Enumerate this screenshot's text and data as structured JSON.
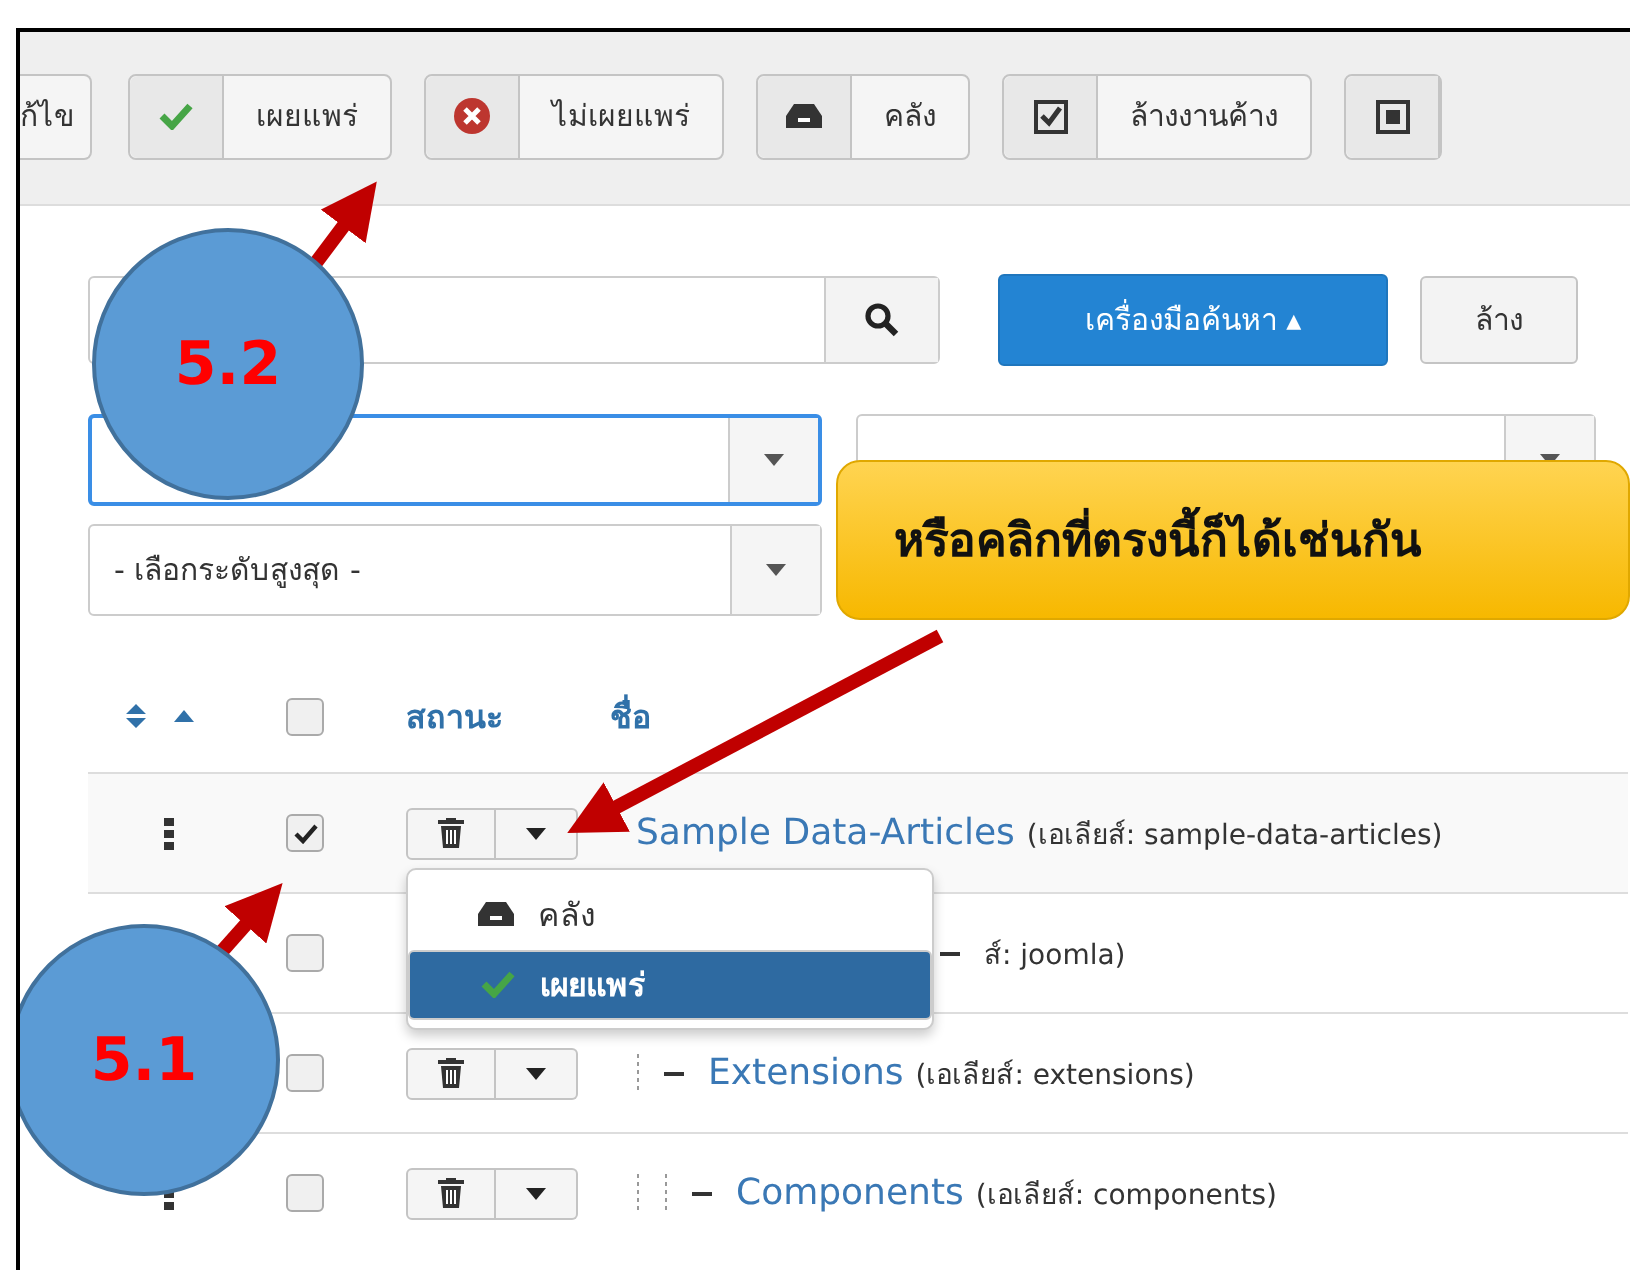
{
  "toolbar": {
    "buttons": [
      {
        "kind": "text",
        "label": "ก้ไข"
      },
      {
        "kind": "publish",
        "label": "เผยแพร่"
      },
      {
        "kind": "unpublish",
        "label": "ไม่เผยแพร่"
      },
      {
        "kind": "archive",
        "label": "คลัง"
      },
      {
        "kind": "checkin",
        "label": "ล้างงานค้าง"
      },
      {
        "kind": "stop"
      }
    ]
  },
  "search": {
    "tools_button": "เครื่องมือค้นหา ▴",
    "clear_button": "ล้าง"
  },
  "filters": [
    {
      "focused": true
    },
    {
      "focused": false
    },
    {
      "focused": false,
      "value": "- เลือกระดับสูงสุด -"
    }
  ],
  "table": {
    "select_all": {
      "checked": false
    },
    "columns": [
      "สถานะ",
      "ชื่อ"
    ],
    "rows": [
      {
        "name": "Sample Data-Articles",
        "alias": "(เอเลียส์: sample-data-articles)",
        "checked": true,
        "status_menu": [
          {
            "kind": "archive",
            "label": "คลัง",
            "selected": false
          },
          {
            "kind": "publish",
            "label": "เผยแพร่",
            "selected": true
          }
        ],
        "children": [
          {
            "alias": "ส์: joomla)",
            "checked": false,
            "children": [
              {
                "name": "Extensions",
                "alias": "(เอเลียส์: extensions)",
                "checked": false,
                "children": [
                  {
                    "name": "Components",
                    "alias": "(เอเลียส์: components)",
                    "checked": false
                  }
                ]
              }
            ]
          }
        ]
      }
    ]
  },
  "annotations": [
    {
      "kind": "badge",
      "label": "5.2"
    },
    {
      "kind": "badge",
      "label": "5.1"
    },
    {
      "kind": "callout",
      "label": "หรือคลิกที่ตรงนี้ก็ได้เช่นกัน"
    }
  ]
}
